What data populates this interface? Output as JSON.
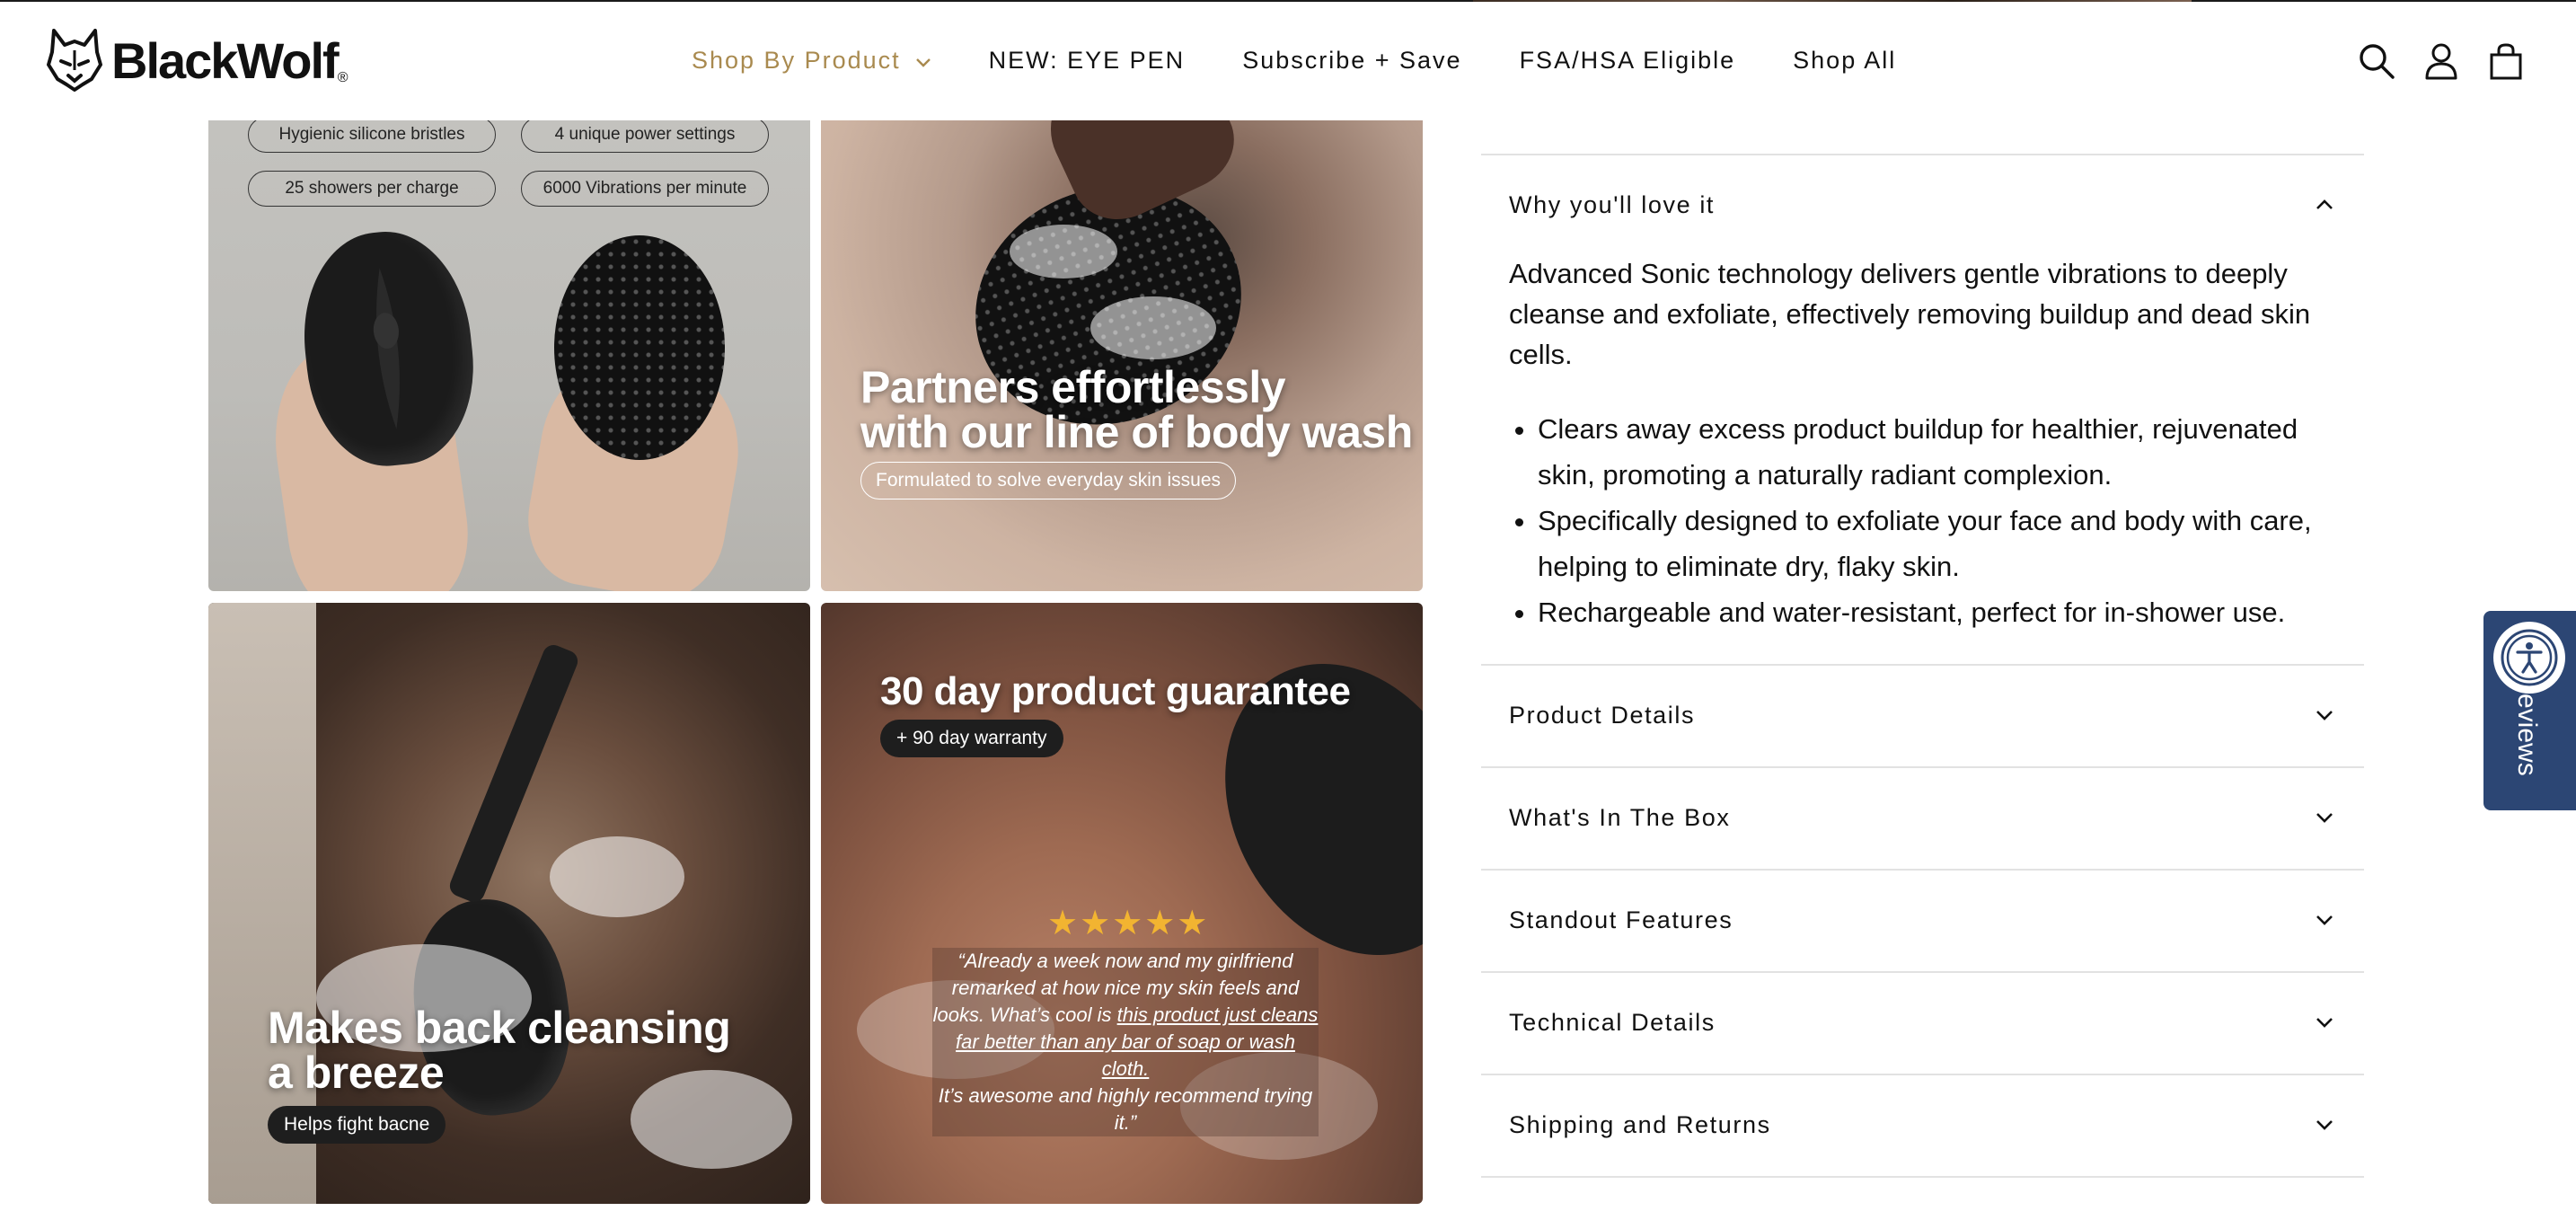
{
  "brand": {
    "name": "BlackWolf",
    "reg_mark": "®",
    "logo_icon": "wolf-head-icon"
  },
  "nav": {
    "items": [
      {
        "label": "Shop By Product",
        "has_dropdown": true,
        "active": true
      },
      {
        "label": "NEW: EYE PEN"
      },
      {
        "label": "Subscribe + Save"
      },
      {
        "label": "FSA/HSA Eligible"
      },
      {
        "label": "Shop All"
      }
    ],
    "icons": [
      "search-icon",
      "account-icon",
      "cart-icon"
    ]
  },
  "gallery": {
    "tile1": {
      "pills": [
        "Hygienic silicone bristles",
        "4 unique power settings",
        "25 showers per charge",
        "6000 Vibrations per minute"
      ]
    },
    "tile2": {
      "title_line1": "Partners effortlessly",
      "title_line2": "with our line of body wash",
      "subtitle": "Formulated to solve everyday skin issues"
    },
    "tile3": {
      "title_line1": "Makes back cleansing",
      "title_line2": "a breeze",
      "subtitle": "Helps fight bacne"
    },
    "tile4": {
      "title": "30 day product guarantee",
      "subtitle": "+ 90 day warranty",
      "stars": "★★★★★",
      "quote_part1": "“Already a week now and my girlfriend remarked at how nice my skin feels and looks. What’s cool is",
      "quote_underlined": "this product just cleans far better than any bar of soap or wash cloth.",
      "quote_part2": "It’s awesome and highly recommend trying it.”"
    }
  },
  "accordion": {
    "open": {
      "label": "Why you'll love it",
      "paragraph": "Advanced Sonic technology delivers gentle vibrations to deeply cleanse and exfoliate, effectively removing buildup and dead skin cells.",
      "bullets": [
        "Clears away excess product buildup for healthier, rejuvenated skin, promoting a naturally radiant complexion.",
        "Specifically designed to exfoliate your face and body with care, helping to eliminate dry, flaky skin.",
        "Rechargeable and water-resistant, perfect for in-shower use."
      ]
    },
    "closed": [
      {
        "label": "Product Details"
      },
      {
        "label": "What's In The Box"
      },
      {
        "label": "Standout Features"
      },
      {
        "label": "Technical Details"
      },
      {
        "label": "Shipping and Returns"
      }
    ]
  },
  "reviews_tab": {
    "label": "Reviews",
    "visible_label": "eviews",
    "accessibility_icon": "accessibility-icon"
  },
  "colors": {
    "nav_active": "#a98a4f",
    "reviews_tab": "#2c4674",
    "star": "#f2b431"
  }
}
